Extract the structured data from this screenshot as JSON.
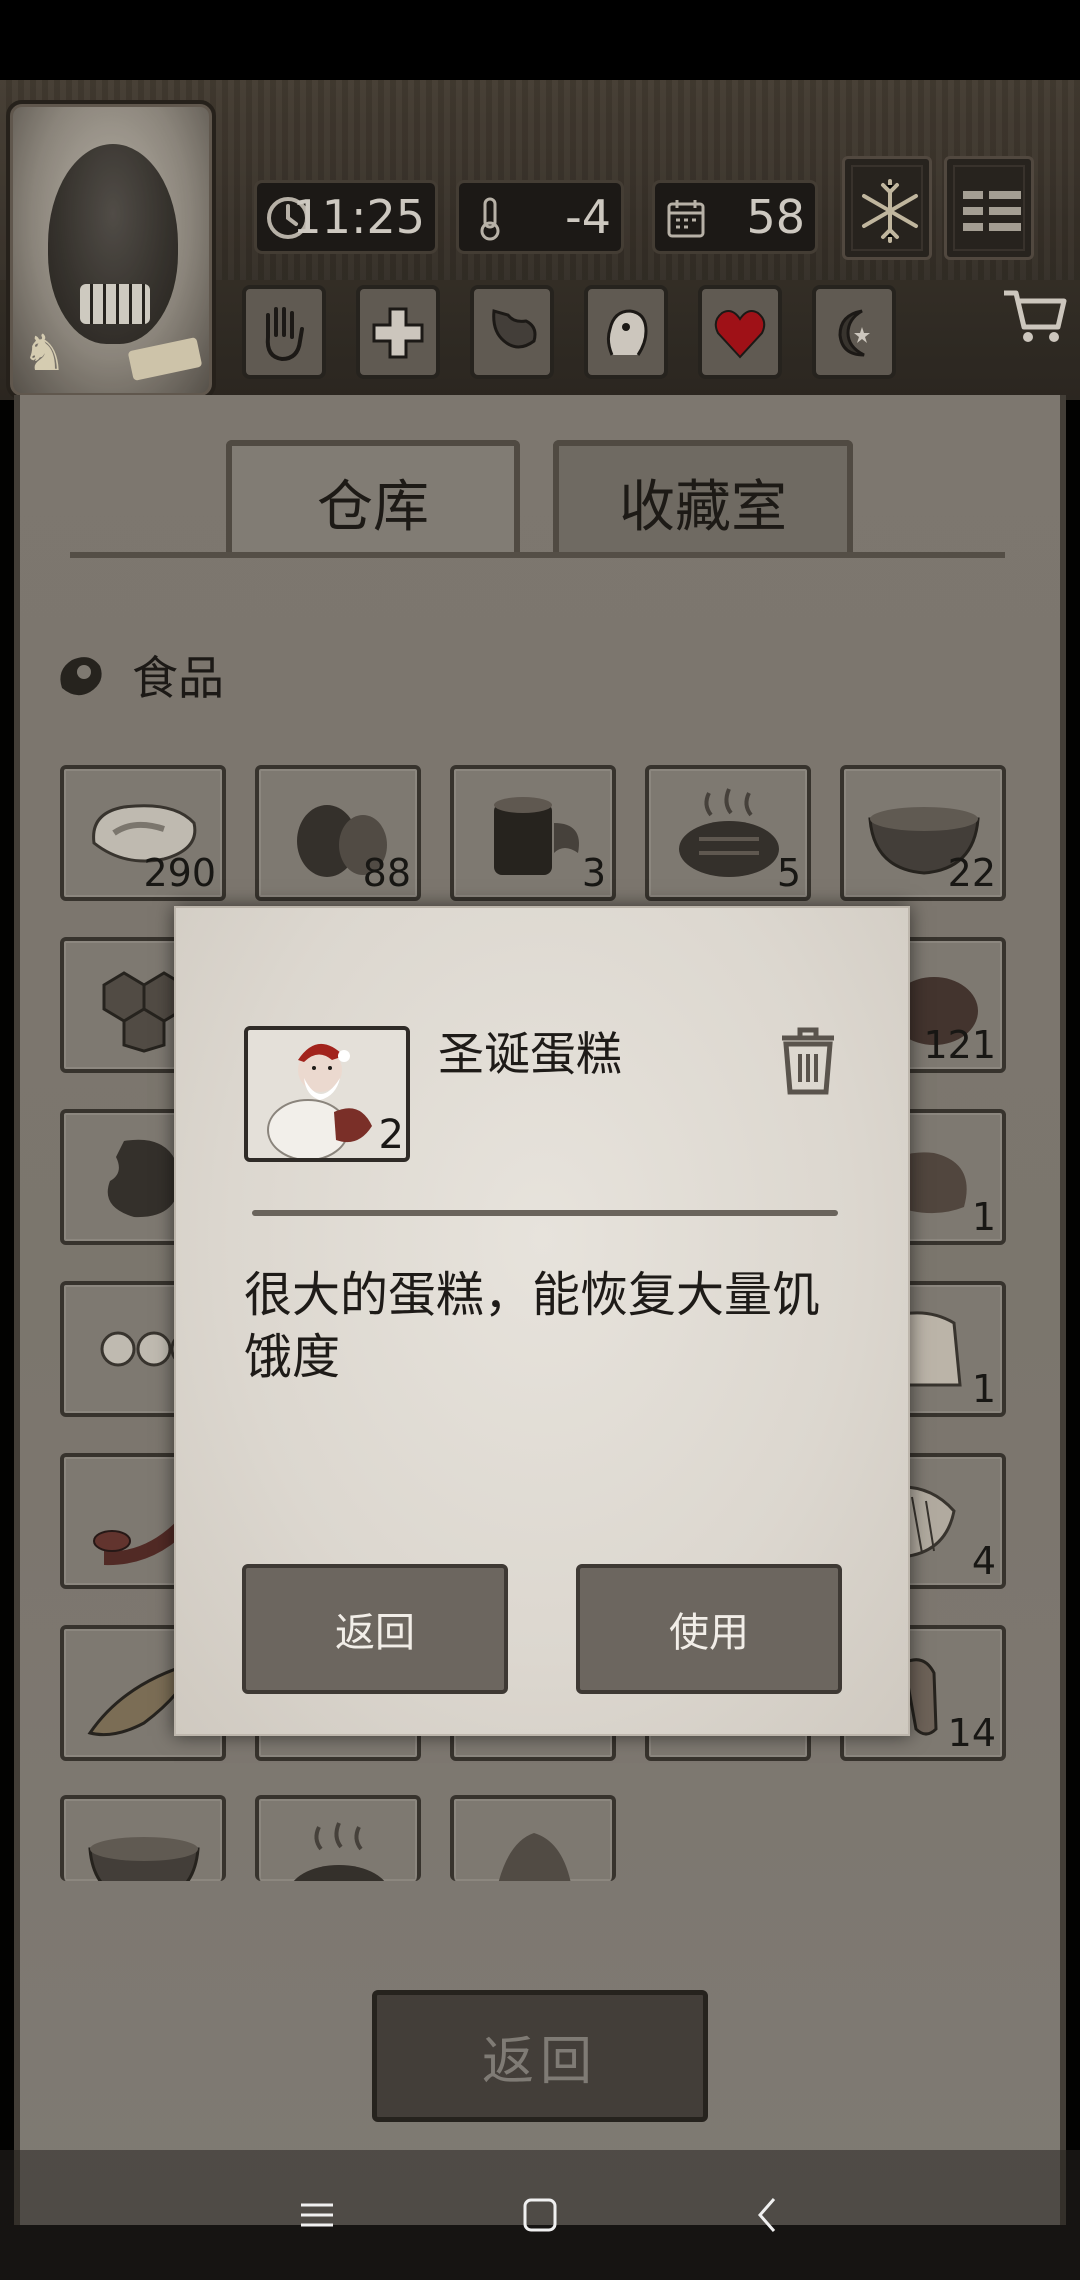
{
  "hud": {
    "time": "11:25",
    "temperature": "-4",
    "day": "58",
    "icons": {
      "clock": "clock-icon",
      "temperature": "thermometer-icon",
      "calendar": "calendar-icon",
      "weather": "snowflake-icon",
      "menu": "menu-icon",
      "cart": "cart-icon"
    },
    "actions": [
      "hand-icon",
      "plus-icon",
      "stomach-icon",
      "head-icon",
      "heart-icon",
      "moon-icon"
    ]
  },
  "tabs": [
    {
      "label": "仓库",
      "active": true
    },
    {
      "label": "收藏室",
      "active": false
    }
  ],
  "category": {
    "label": "食品",
    "icon": "meat-icon"
  },
  "grid": {
    "row1": [
      {
        "icon": "steak-icon",
        "count": "290"
      },
      {
        "icon": "coconut-icon",
        "count": "88"
      },
      {
        "icon": "chocolate-icon",
        "count": "3"
      },
      {
        "icon": "grilled-meat-icon",
        "count": "5"
      },
      {
        "icon": "soup-bowl-icon",
        "count": "22"
      }
    ],
    "right_column": [
      {
        "icon": "bread-icon",
        "count": "121"
      },
      {
        "icon": "roast-icon",
        "count": "1"
      },
      {
        "icon": "pudding-icon",
        "count": "1"
      },
      {
        "icon": "fish-basket-icon",
        "count": "4"
      },
      {
        "icon": "drumstick-icon",
        "count": "14"
      }
    ],
    "left_column": [
      {
        "icon": "honeycomb-icon"
      },
      {
        "icon": "bean-icon"
      },
      {
        "icon": "eggs-icon"
      },
      {
        "icon": "sausage-icon"
      },
      {
        "icon": "fish-icon"
      }
    ],
    "bottom_row": [
      {
        "icon": "soup-bowl-icon"
      },
      {
        "icon": "grilled-meat-icon"
      },
      {
        "icon": "herb-icon"
      }
    ]
  },
  "dialog": {
    "item_name": "圣诞蛋糕",
    "item_count": "2",
    "item_icon": "santa-cake-icon",
    "description": "很大的蛋糕，能恢复大量饥饿度",
    "back_label": "返回",
    "use_label": "使用"
  },
  "bottom": {
    "back_label": "返回"
  }
}
